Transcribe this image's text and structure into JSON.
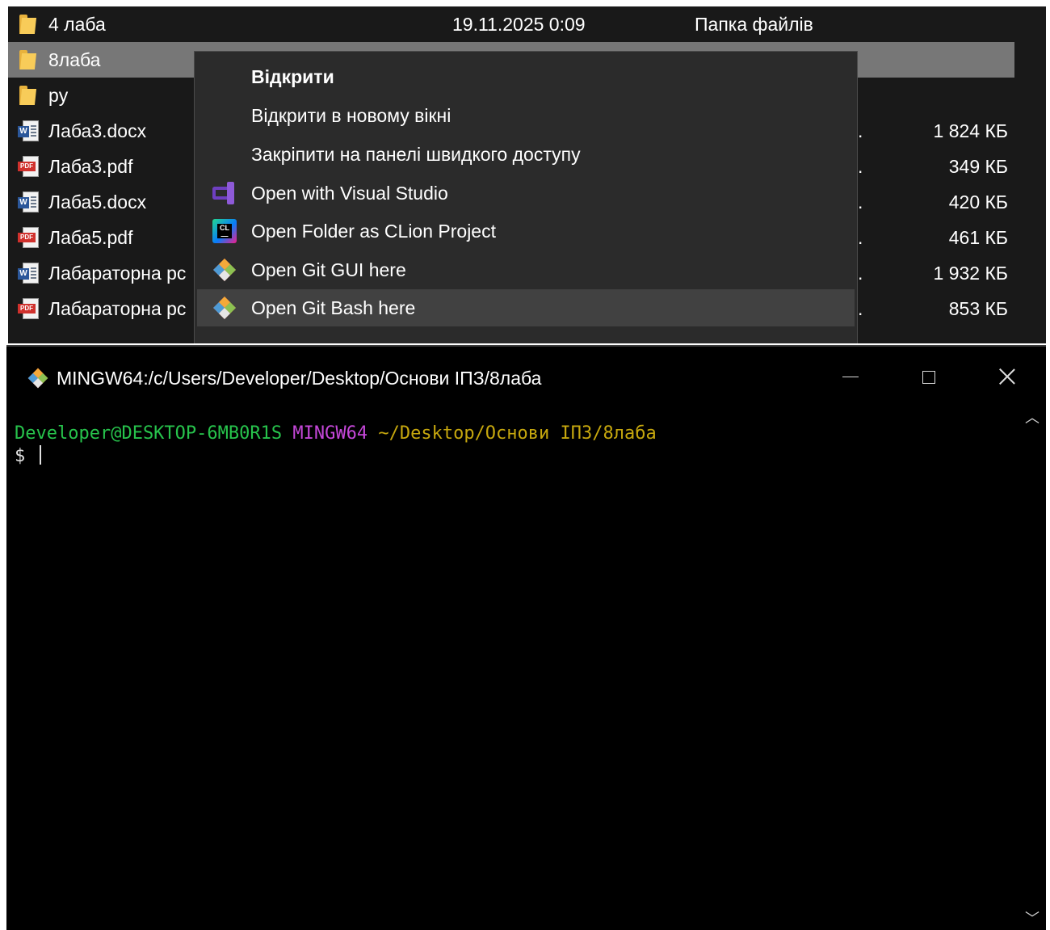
{
  "explorer": {
    "files": [
      {
        "name": "4 лаба",
        "icon": "folder-icon",
        "date": "19.11.2025 0:09",
        "type": "Папка файлів",
        "size": ""
      },
      {
        "name": "8лаба",
        "icon": "folder-icon",
        "selected": true,
        "date": "",
        "type": "",
        "size": ""
      },
      {
        "name": "py",
        "icon": "folder-icon",
        "date": "",
        "type": "",
        "size": ""
      },
      {
        "name": "Лаба3.docx",
        "icon": "word-doc-icon",
        "date": "",
        "type": ".",
        "size": "1 824 КБ"
      },
      {
        "name": "Лаба3.pdf",
        "icon": "pdf-icon",
        "date": "",
        "type": ".",
        "size": "349 КБ"
      },
      {
        "name": "Лаба5.docx",
        "icon": "word-doc-icon",
        "date": "",
        "type": ".",
        "size": "420 КБ"
      },
      {
        "name": "Лаба5.pdf",
        "icon": "pdf-icon",
        "date": "",
        "type": ".",
        "size": "461 КБ"
      },
      {
        "name": "Лабараторна рс",
        "icon": "word-doc-icon",
        "date": "",
        "type": ".",
        "size": "1 932 КБ"
      },
      {
        "name": "Лабараторна рс",
        "icon": "pdf-icon",
        "date": "",
        "type": ".",
        "size": "853 КБ"
      }
    ]
  },
  "context_menu": {
    "items": [
      {
        "label": "Відкрити",
        "bold": true,
        "icon": ""
      },
      {
        "label": "Відкрити в новому вікні",
        "icon": ""
      },
      {
        "label": "Закріпити на панелі швидкого доступу",
        "icon": ""
      },
      {
        "label": "Open with Visual Studio",
        "icon": "visual-studio-icon"
      },
      {
        "label": "Open Folder as CLion Project",
        "icon": "clion-icon"
      },
      {
        "label": "Open Git GUI here",
        "icon": "git-icon"
      },
      {
        "label": "Open Git Bash here",
        "icon": "git-icon",
        "highlighted": true
      }
    ]
  },
  "terminal": {
    "title": "MINGW64:/c/Users/Developer/Desktop/Основи ІПЗ/8лаба",
    "prompt_user": "Developer@DESKTOP-6MB0R1S",
    "prompt_env": "MINGW64",
    "prompt_path": "~/Desktop/Основи ІПЗ/8лаба",
    "prompt_symbol": "$",
    "colors": {
      "user": "#27c34c",
      "env": "#c447d8",
      "path": "#c6a70e"
    }
  },
  "window_controls": {
    "minimize": "minimize-icon",
    "maximize": "maximize-icon",
    "close": "close-icon"
  }
}
